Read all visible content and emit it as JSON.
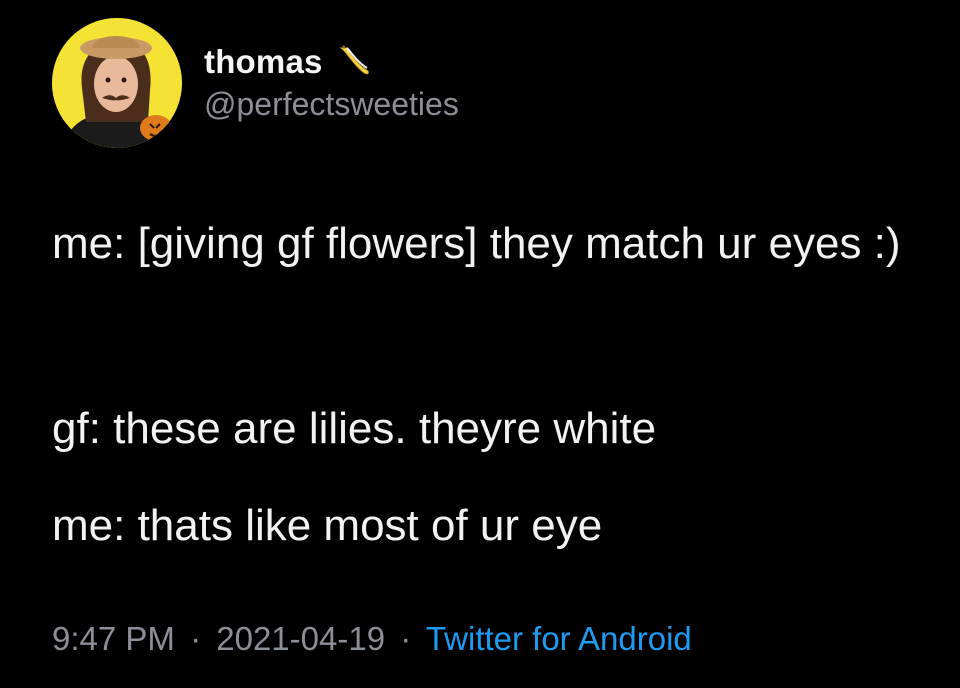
{
  "user": {
    "display_name": "thomas",
    "handle": "@perfectsweeties",
    "badge_icon": "banana-icon",
    "avatar_bg": "#f4e234"
  },
  "tweet": {
    "lines": [
      "me: [giving gf flowers] they match ur eyes :)",
      "gf: these are lilies. theyre white",
      "me: thats like most of ur eye"
    ]
  },
  "meta": {
    "time": "9:47 PM",
    "separator": "·",
    "date": "2021-04-19",
    "source": "Twitter for Android",
    "source_color": "#1d9bf0",
    "muted_color": "#8b9096"
  }
}
